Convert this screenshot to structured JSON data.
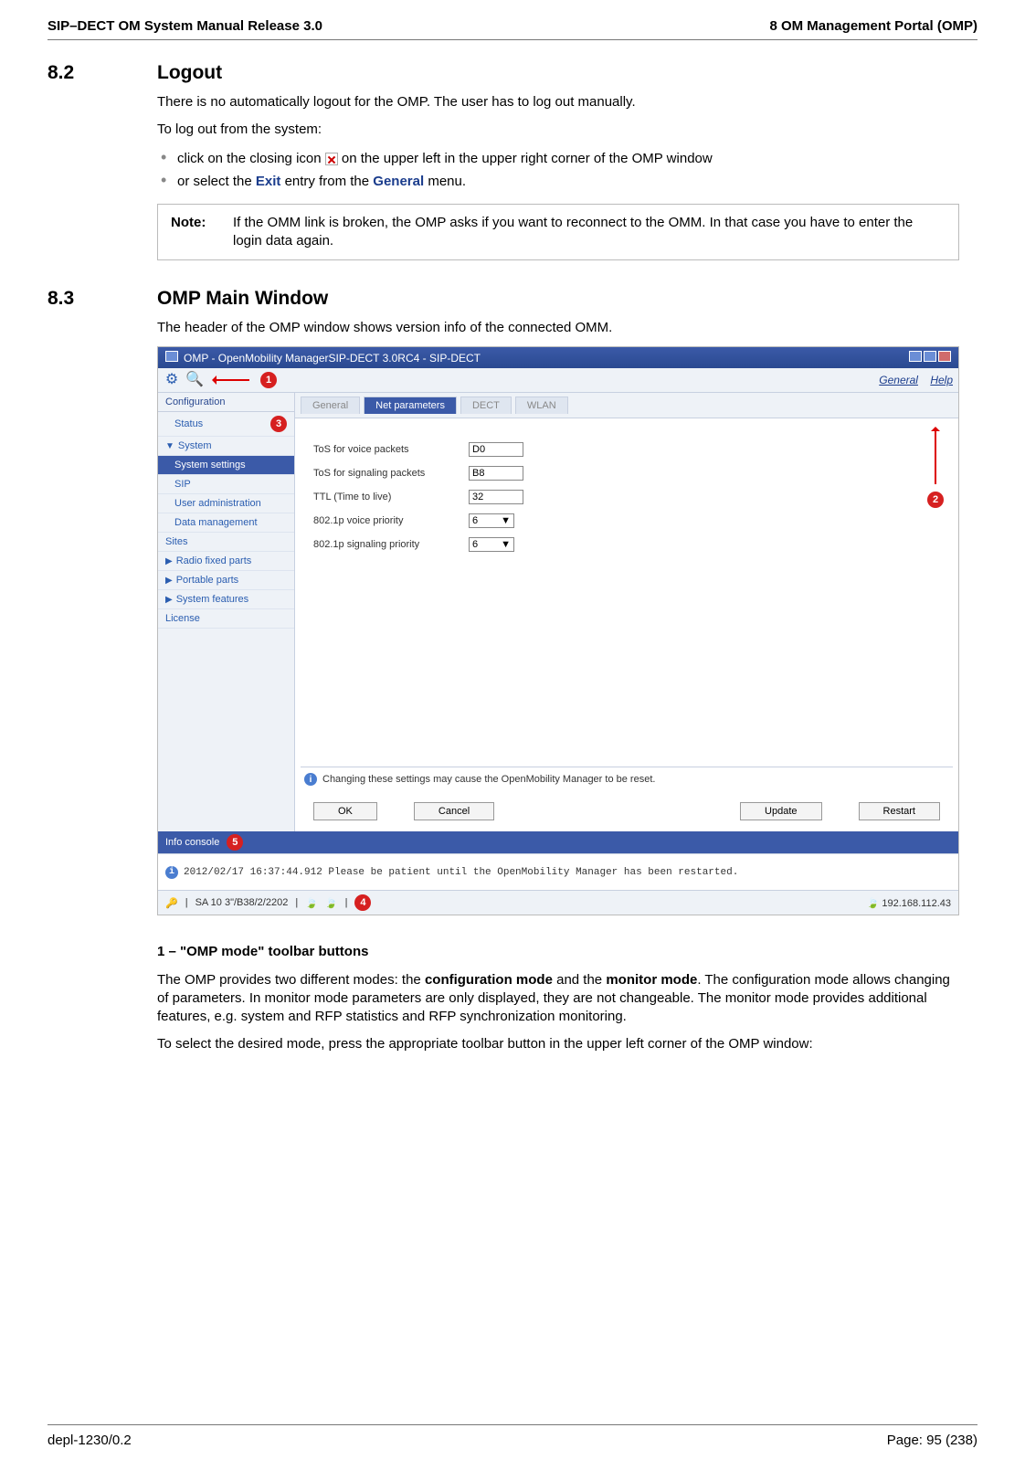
{
  "header": {
    "left": "SIP–DECT OM System Manual Release 3.0",
    "right": "8 OM Management Portal (OMP)"
  },
  "sec82": {
    "num": "8.2",
    "title": "Logout",
    "p1": "There is no automatically logout for the OMP. The user has to log out manually.",
    "p2": "To log out from the system:",
    "b1a": "click on the closing icon ",
    "b1b": " on the upper left in the upper right corner of the OMP window",
    "b2a": "or select the ",
    "b2_exit": "Exit",
    "b2b": " entry from the ",
    "b2_general": "General",
    "b2c": " menu.",
    "note_label": "Note:",
    "note_text": "If the OMM link is broken, the OMP asks if you want to reconnect to the OMM. In that case you have to enter the login data again."
  },
  "sec83": {
    "num": "8.3",
    "title": "OMP Main Window",
    "intro": "The header of the OMP window shows version info of the connected OMM."
  },
  "fig": {
    "win_title": "OMP - OpenMobility ManagerSIP-DECT 3.0RC4 - SIP-DECT",
    "menu_general": "General",
    "menu_help": "Help",
    "nav_header": "Configuration",
    "nav": {
      "status": "Status",
      "system": "System",
      "system_settings": "System settings",
      "sip": "SIP",
      "user_admin": "User administration",
      "data_mgmt": "Data management",
      "sites": "Sites",
      "rfp": "Radio fixed parts",
      "pp": "Portable parts",
      "sysfeat": "System features",
      "license": "License"
    },
    "tabs": {
      "t1": "General",
      "t2": "Net parameters",
      "t3": "DECT",
      "t4": "WLAN"
    },
    "form": {
      "tos_voice_l": "ToS for voice packets",
      "tos_voice_v": "D0",
      "tos_sig_l": "ToS for signaling packets",
      "tos_sig_v": "B8",
      "ttl_l": "TTL (Time to live)",
      "ttl_v": "32",
      "vprio_l": "802.1p voice priority",
      "vprio_v": "6",
      "sprio_l": "802.1p signaling priority",
      "sprio_v": "6"
    },
    "info_strip": "Changing these settings may cause the OpenMobility Manager to be reset.",
    "buttons": {
      "ok": "OK",
      "cancel": "Cancel",
      "update": "Update",
      "restart": "Restart"
    },
    "info_console_label": "Info console",
    "console_msg": "2012/02/17 16:37:44.912 Please be patient until the OpenMobility Manager has been restarted.",
    "status_left": "SA 10 3\"/B38/2/2202",
    "status_right": "192.168.112.43",
    "badges": {
      "b1": "1",
      "b2": "2",
      "b3": "3",
      "b4": "4",
      "b5": "5"
    }
  },
  "subsection": {
    "head": "1 – \"OMP mode\" toolbar buttons",
    "p1a": "The OMP provides two different modes: the ",
    "p1_conf": "configuration mode",
    "p1b": " and the ",
    "p1_mon": "monitor mode",
    "p1c": ". The configuration mode allows changing of parameters. In monitor mode parameters are only displayed, they are not changeable. The monitor mode provides additional features, e.g. system and RFP statistics and RFP synchronization monitoring.",
    "p2": "To select the desired mode, press the appropriate toolbar button in the upper left corner of the OMP window:"
  },
  "footer": {
    "left": "depl-1230/0.2",
    "right": "Page: 95 (238)"
  }
}
